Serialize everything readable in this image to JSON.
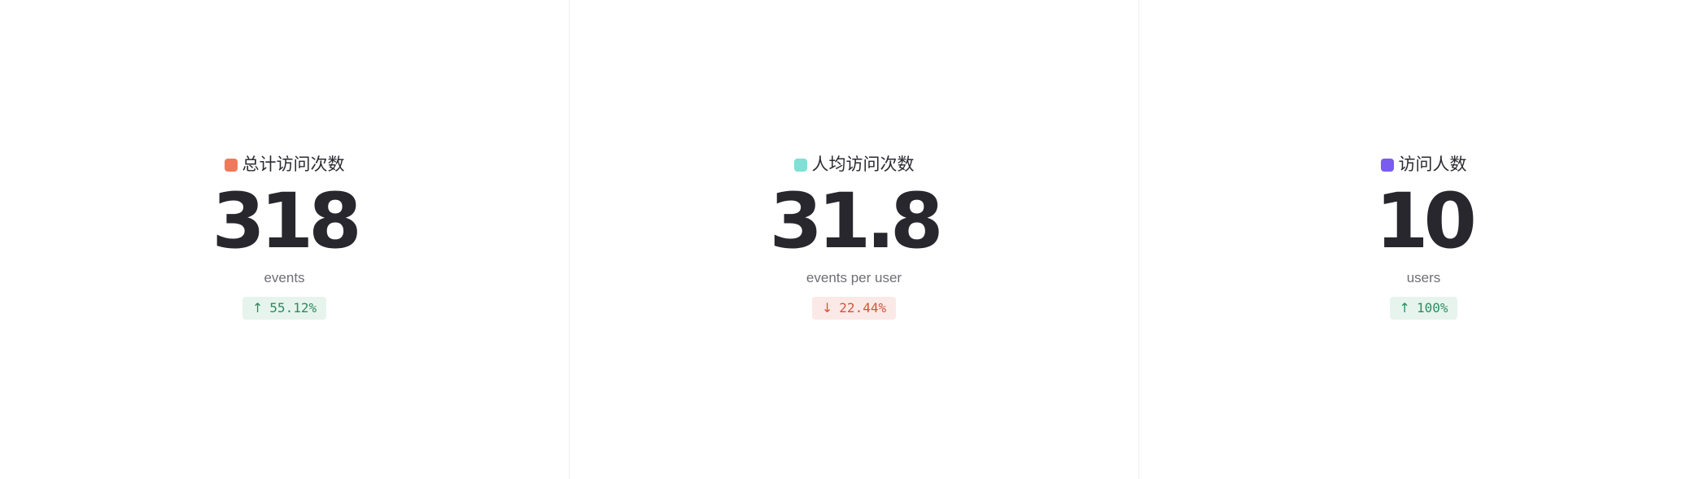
{
  "metrics": [
    {
      "label": "总计访问次数",
      "color": "#f0795a",
      "value": "318",
      "unit": "events",
      "change": {
        "direction": "up",
        "arrow": "↑",
        "text": "55.12%"
      }
    },
    {
      "label": "人均访问次数",
      "color": "#7fe0d5",
      "value": "31.8",
      "unit": "events per user",
      "change": {
        "direction": "down",
        "arrow": "↓",
        "text": "22.44%"
      }
    },
    {
      "label": "访问人数",
      "color": "#7a5cf0",
      "value": "10",
      "unit": "users",
      "change": {
        "direction": "up",
        "arrow": "↑",
        "text": "100%"
      }
    }
  ]
}
